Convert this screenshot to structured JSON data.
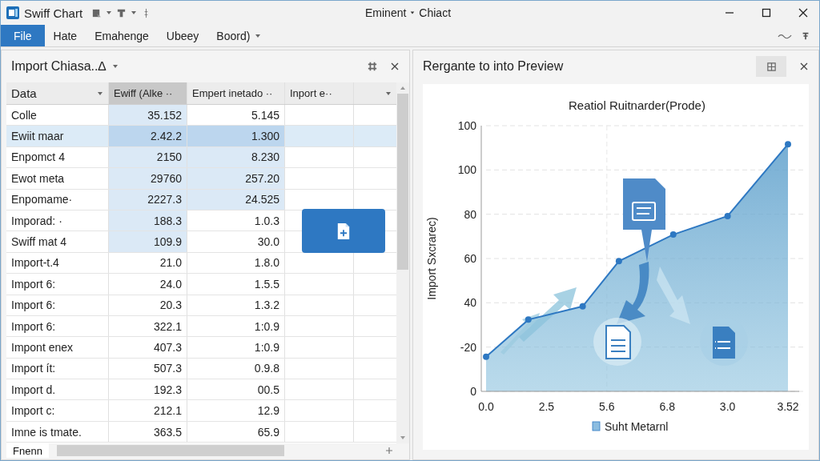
{
  "window": {
    "title": "Swiff Chart",
    "document": "Eminent",
    "subtitle": "Chiact"
  },
  "menu": [
    {
      "label": "File",
      "selected": true,
      "dropdown": false
    },
    {
      "label": "Hate",
      "selected": false,
      "dropdown": false
    },
    {
      "label": "Emahenge",
      "selected": false,
      "dropdown": false
    },
    {
      "label": "Ubeey",
      "selected": false,
      "dropdown": false
    },
    {
      "label": "Boord)",
      "selected": false,
      "dropdown": true
    }
  ],
  "left_panel": {
    "title": "Import Chiasa..∆",
    "columns": [
      {
        "label": "Data",
        "selected": false,
        "dropdown": true
      },
      {
        "label": "Ewiff (Alke ··",
        "selected": true,
        "dropdown": false
      },
      {
        "label": "Empert inetado ··",
        "selected": false,
        "dropdown": false
      },
      {
        "label": "Inport e··",
        "selected": false,
        "dropdown": false
      },
      {
        "selected": false,
        "dropdown": true
      }
    ],
    "rows": [
      {
        "selected": false,
        "cells": [
          {
            "text": "Colle",
            "selected": false
          },
          {
            "text": "35.152",
            "selected": true
          },
          {
            "text": "5.145",
            "selected": false
          }
        ]
      },
      {
        "selected": true,
        "cells": [
          {
            "text": "Ewiit maar",
            "selected": false
          },
          {
            "text": "2.42.2",
            "selected": true
          },
          {
            "text": "1.300",
            "selected": true
          }
        ]
      },
      {
        "selected": false,
        "cells": [
          {
            "text": "Enpomct 4",
            "selected": false
          },
          {
            "text": "2150",
            "selected": true
          },
          {
            "text": "8.230",
            "selected": true
          }
        ]
      },
      {
        "selected": false,
        "cells": [
          {
            "text": "Ewot meta",
            "selected": false
          },
          {
            "text": "29760",
            "selected": true
          },
          {
            "text": "257.20",
            "selected": true
          }
        ]
      },
      {
        "selected": false,
        "cells": [
          {
            "text": "Enpomame·",
            "selected": false
          },
          {
            "text": "2227.3",
            "selected": true
          },
          {
            "text": "24.525",
            "selected": true
          }
        ]
      },
      {
        "selected": false,
        "cells": [
          {
            "text": "Imporad: ·",
            "selected": false
          },
          {
            "text": "188.3",
            "selected": true
          },
          {
            "text": "1.0.3",
            "selected": false
          }
        ]
      },
      {
        "selected": false,
        "cells": [
          {
            "text": "Swiff mat 4",
            "selected": false
          },
          {
            "text": "109.9",
            "selected": true
          },
          {
            "text": "30.0",
            "selected": false
          }
        ]
      },
      {
        "selected": false,
        "cells": [
          {
            "text": "Import-t.4",
            "selected": false
          },
          {
            "text": "21.0",
            "selected": false
          },
          {
            "text": "1.8.0",
            "selected": false
          }
        ]
      },
      {
        "selected": false,
        "cells": [
          {
            "text": "Import 6:",
            "selected": false
          },
          {
            "text": "24.0",
            "selected": false
          },
          {
            "text": "1.5.5",
            "selected": false
          }
        ]
      },
      {
        "selected": false,
        "cells": [
          {
            "text": "Import 6:",
            "selected": false
          },
          {
            "text": "20.3",
            "selected": false
          },
          {
            "text": "1.3.2",
            "selected": false
          }
        ]
      },
      {
        "selected": false,
        "cells": [
          {
            "text": "Import 6:",
            "selected": false
          },
          {
            "text": "322.1",
            "selected": false
          },
          {
            "text": "1:0.9",
            "selected": false
          }
        ]
      },
      {
        "selected": false,
        "cells": [
          {
            "text": "Impont enex",
            "selected": false
          },
          {
            "text": "407.3",
            "selected": false
          },
          {
            "text": "1:0.9",
            "selected": false
          }
        ]
      },
      {
        "selected": false,
        "cells": [
          {
            "text": "Import ít:",
            "selected": false
          },
          {
            "text": "507.3",
            "selected": false
          },
          {
            "text": "0.9.8",
            "selected": false
          }
        ]
      },
      {
        "selected": false,
        "cells": [
          {
            "text": "Import d.",
            "selected": false
          },
          {
            "text": "192.3",
            "selected": false
          },
          {
            "text": "00.5",
            "selected": false
          }
        ]
      },
      {
        "selected": false,
        "cells": [
          {
            "text": "Import c:",
            "selected": false
          },
          {
            "text": "212.1",
            "selected": false
          },
          {
            "text": "12.9",
            "selected": false
          }
        ]
      },
      {
        "selected": false,
        "cells": [
          {
            "text": "Imne is tmate.",
            "selected": false
          },
          {
            "text": "363.5",
            "selected": false
          },
          {
            "text": "65.9",
            "selected": false
          }
        ]
      }
    ],
    "sheet_tabs": [
      {
        "label": "Fnenn",
        "selected": true
      }
    ]
  },
  "right_panel": {
    "title": "Rergante to into Preview",
    "chart": {
      "title": "Reatiol Ruitnarder(Prode)",
      "ylabel": "Import Sxcrarec)",
      "legend": "Suht Metarnl",
      "x_tick_labels": [
        "0.0",
        "2.5",
        "5.6",
        "6.8",
        "3.0",
        "3.52"
      ],
      "y_tick_labels": [
        "100",
        "100",
        "80",
        "60",
        "40",
        "-20",
        "0"
      ]
    }
  }
}
